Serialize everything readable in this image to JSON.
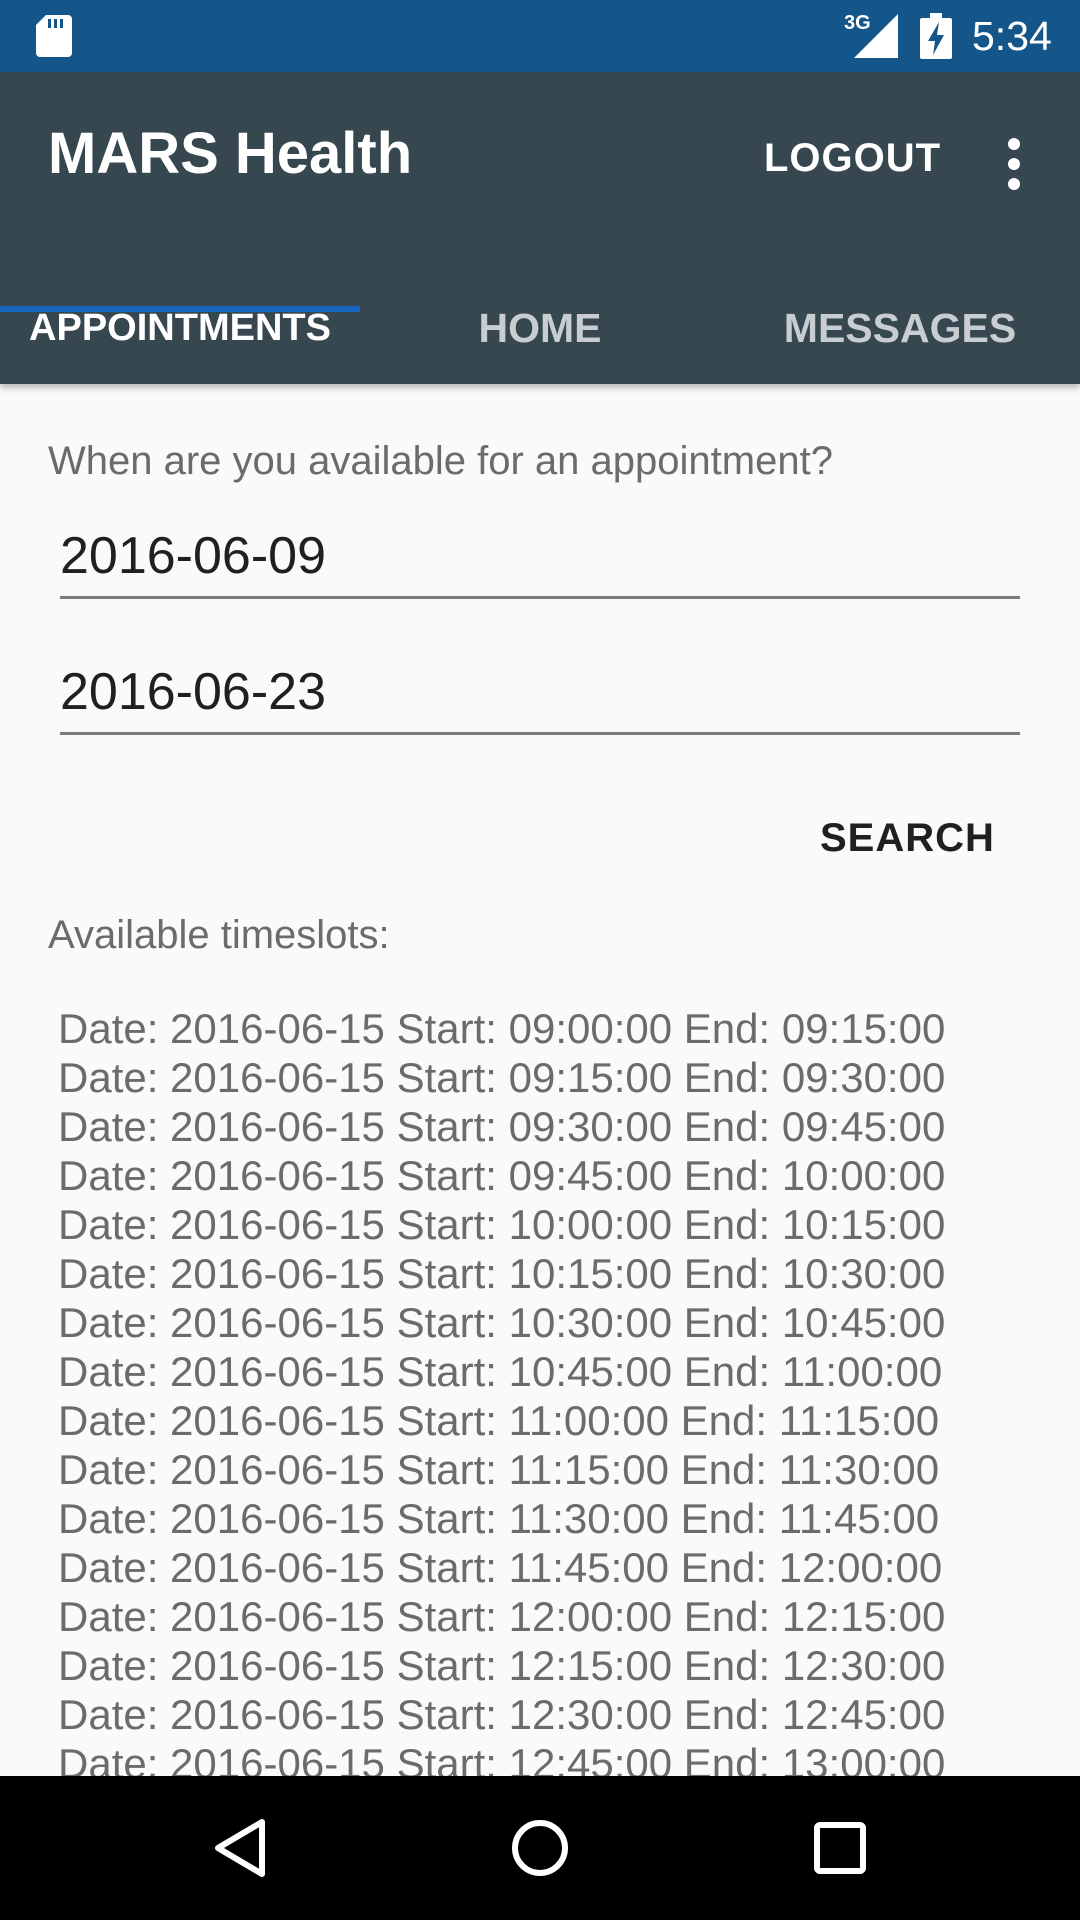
{
  "status_bar": {
    "network": "3G",
    "time": "5:34",
    "icons": [
      "sd-card-icon",
      "signal-icon",
      "battery-charging-icon"
    ],
    "background_color": "#15568a"
  },
  "app_bar": {
    "title": "MARS Health",
    "logout_label": "LOGOUT",
    "overflow_icon": "more-vert-icon",
    "background_color": "#37474f"
  },
  "tabs": [
    {
      "label": "APPOINTMENTS",
      "selected": true
    },
    {
      "label": "HOME",
      "selected": false
    },
    {
      "label": "MESSAGES",
      "selected": false
    }
  ],
  "accent_color": "#1565c0",
  "form": {
    "prompt": "When are you available for an appointment?",
    "start_date": "2016-06-09",
    "end_date": "2016-06-23",
    "search_label": "SEARCH"
  },
  "timeslots": {
    "label": "Available timeslots:",
    "items": [
      "Date: 2016-06-15 Start: 09:00:00 End: 09:15:00",
      "Date: 2016-06-15 Start: 09:15:00 End: 09:30:00",
      "Date: 2016-06-15 Start: 09:30:00 End: 09:45:00",
      "Date: 2016-06-15 Start: 09:45:00 End: 10:00:00",
      "Date: 2016-06-15 Start: 10:00:00 End: 10:15:00",
      "Date: 2016-06-15 Start: 10:15:00 End: 10:30:00",
      "Date: 2016-06-15 Start: 10:30:00 End: 10:45:00",
      "Date: 2016-06-15 Start: 10:45:00 End: 11:00:00",
      "Date: 2016-06-15 Start: 11:00:00 End: 11:15:00",
      "Date: 2016-06-15 Start: 11:15:00 End: 11:30:00",
      "Date: 2016-06-15 Start: 11:30:00 End: 11:45:00",
      "Date: 2016-06-15 Start: 11:45:00 End: 12:00:00",
      "Date: 2016-06-15 Start: 12:00:00 End: 12:15:00",
      "Date: 2016-06-15 Start: 12:15:00 End: 12:30:00",
      "Date: 2016-06-15 Start: 12:30:00 End: 12:45:00",
      "Date: 2016-06-15 Start: 12:45:00 End: 13:00:00"
    ]
  },
  "nav_bar": {
    "icons": [
      "back-icon",
      "home-icon",
      "recents-icon"
    ]
  }
}
